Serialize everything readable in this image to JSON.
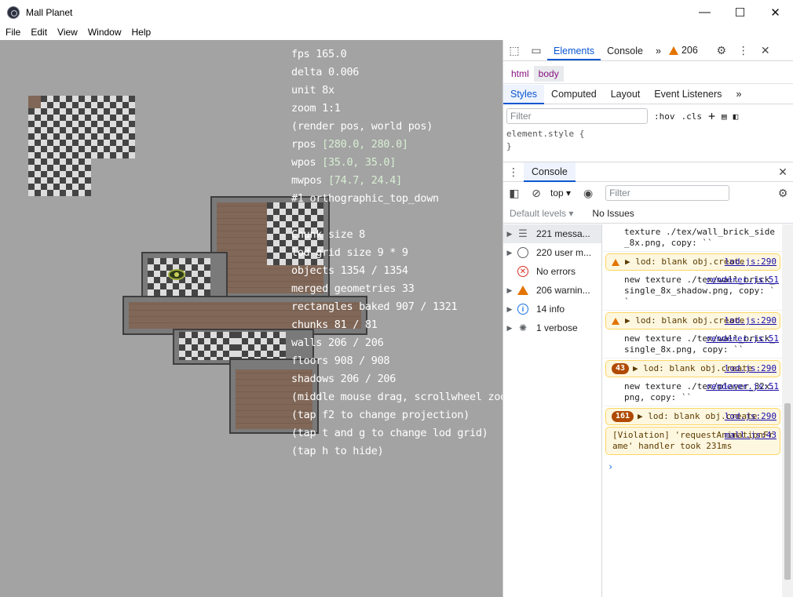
{
  "window": {
    "title": "Mall Planet",
    "minimize": "—",
    "maximize": "☐",
    "close": "✕"
  },
  "menu": [
    "File",
    "Edit",
    "View",
    "Window",
    "Help"
  ],
  "overlay": {
    "lines": [
      {
        "text": "fps 165.0"
      },
      {
        "text": "delta 0.006"
      },
      {
        "text": "unit 8x"
      },
      {
        "text": "zoom 1:1"
      },
      {
        "text": "(render pos, world pos)"
      },
      {
        "label": "rpos ",
        "value": "[280.0, 280.0]"
      },
      {
        "label": "wpos ",
        "value": "[35.0, 35.0]"
      },
      {
        "label": "mwpos ",
        "value": "[74.7, 24.4]"
      },
      {
        "text": "#1 orthographic_top_down"
      },
      {
        "text": ""
      },
      {
        "text": "Chunk size 8"
      },
      {
        "text": "lod grid size 9 * 9"
      },
      {
        "text": "objects 1354 / 1354"
      },
      {
        "text": "merged geometries 33"
      },
      {
        "text": "rectangles baked 907 / 1321"
      },
      {
        "text": "chunks 81 / 81"
      },
      {
        "text": "walls 206 / 206"
      },
      {
        "text": "floors 908 / 908"
      },
      {
        "text": "shadows 206 / 206"
      },
      {
        "text": "(middle mouse drag, scrollwheel zoom)"
      },
      {
        "text": "(tap f2 to change projection)"
      },
      {
        "text": "(tap t and g to change lod grid)"
      },
      {
        "text": "(tap h to hide)"
      }
    ]
  },
  "devtools": {
    "tabs": {
      "elements": "Elements",
      "console": "Console",
      "more": "»",
      "warnings": "206"
    },
    "breadcrumbs": [
      "html",
      "body"
    ],
    "subtabs": [
      "Styles",
      "Computed",
      "Layout",
      "Event Listeners",
      "»"
    ],
    "styles": {
      "filter_placeholder": "Filter",
      "hov": ":hov",
      "cls": ".cls",
      "rule_line1": "element.style {",
      "rule_line2": "}"
    },
    "drawer": {
      "tab": "Console",
      "context": "top",
      "filter_placeholder": "Filter",
      "levels": "Default levels",
      "issues": "No Issues"
    },
    "sidebar": [
      {
        "label": "221 messa...",
        "icon": "list-icon",
        "caret": true,
        "selected": true
      },
      {
        "label": "220 user m...",
        "icon": "user-icon",
        "caret": true
      },
      {
        "label": "No errors",
        "icon": "error-icon",
        "caret": false
      },
      {
        "label": "206 warnin...",
        "icon": "warning-icon",
        "caret": true
      },
      {
        "label": "14 info",
        "icon": "info-icon",
        "caret": true
      },
      {
        "label": "1 verbose",
        "icon": "bug-icon",
        "caret": true
      }
    ],
    "messages": [
      {
        "type": "log",
        "text": "texture ./tex/wall_brick_side_8x.png, copy: ``",
        "src": ""
      },
      {
        "type": "warn",
        "text": "▶ lod: blank obj.create",
        "src": "lod.js:290"
      },
      {
        "type": "log",
        "text": "new texture ./tex/wall_brick_single_8x_shadow.png, copy: ``",
        "src": "renderer.js:51"
      },
      {
        "type": "warn",
        "text": "▶ lod: blank obj.create",
        "src": "lod.js:290"
      },
      {
        "type": "log",
        "text": "new texture ./tex/wall_brick_single_8x.png, copy: ``",
        "src": "renderer.js:51"
      },
      {
        "type": "warn-count",
        "count": "43",
        "text": "▶ lod: blank obj.create",
        "src": "lod.js:290"
      },
      {
        "type": "log",
        "text": "new texture ./tex/player_32x.png, copy: ``",
        "src": "renderer.js:51"
      },
      {
        "type": "warn-count",
        "count": "161",
        "text": "▶ lod: blank obj.create",
        "src": "lod.js:290"
      },
      {
        "type": "violation",
        "text": "[Violation] 'requestAnimationFrame' handler took 231ms",
        "src": "mall.js:43"
      }
    ],
    "prompt": "›"
  }
}
